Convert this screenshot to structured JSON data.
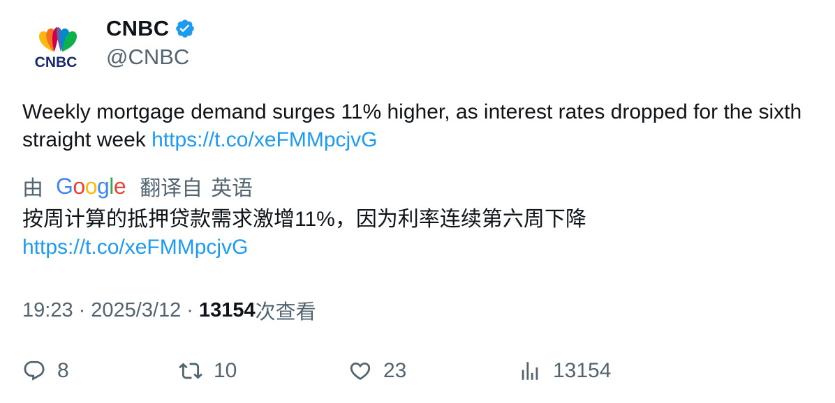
{
  "author": {
    "name": "CNBC",
    "handle": "@CNBC",
    "logo_text": "CNBC",
    "verified_color": "#1d9bf0"
  },
  "tweet": {
    "text": "Weekly mortgage demand surges 11% higher, as interest rates dropped for the sixth straight week ",
    "link": "https://t.co/xeFMMpcjvG"
  },
  "translation": {
    "by_label": "由",
    "provider": "Google",
    "translated_label": "翻译自",
    "source_language": "英语",
    "text": "按周计算的抵押贷款需求激增11%，因为利率连续第六周下降",
    "link": "https://t.co/xeFMMpcjvG"
  },
  "meta": {
    "time": "19:23",
    "separator": "·",
    "date": "2025/3/12",
    "views_count": "13154",
    "views_label": "次查看"
  },
  "actions": {
    "replies": "8",
    "retweets": "10",
    "likes": "23",
    "views": "13154"
  },
  "colors": {
    "link": "#1d9bf0",
    "secondary_text": "#536471",
    "primary_text": "#0f1419"
  },
  "icons": [
    "reply-icon",
    "retweet-icon",
    "like-icon",
    "views-icon",
    "verified-badge-icon",
    "cnbc-peacock-logo"
  ]
}
